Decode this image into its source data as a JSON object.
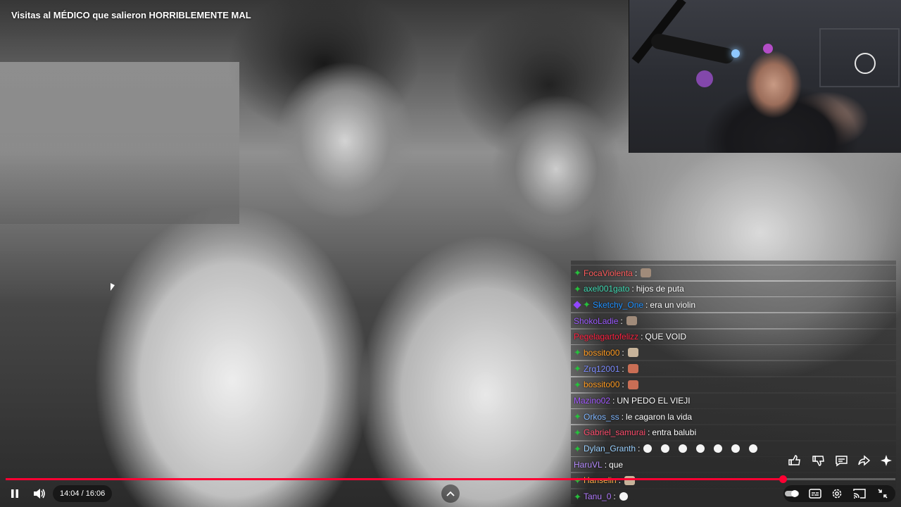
{
  "video": {
    "title": "Visitas al MÉDICO que salieron HORRIBLEMENTE MAL"
  },
  "chat": {
    "messages": [
      {
        "user": "FocaViolenta",
        "color": "#ff5c5c",
        "badges": [
          "green"
        ],
        "text": "",
        "emotes": [
          "cat"
        ]
      },
      {
        "user": "axel001gato",
        "color": "#3fd9b2",
        "badges": [
          "green"
        ],
        "text": "hijos de puta",
        "emotes": []
      },
      {
        "user": "Sketchy_One",
        "color": "#1e90ff",
        "badges": [
          "purple",
          "green"
        ],
        "text": "era un violin",
        "emotes": []
      },
      {
        "user": "ShokoLadie",
        "color": "#9b59ff",
        "badges": [],
        "text": "",
        "emotes": [
          "cat"
        ]
      },
      {
        "user": "Pegelagartofelizz",
        "color": "#ff2040",
        "badges": [],
        "text": "QUE VOID",
        "emotes": []
      },
      {
        "user": "bossito00",
        "color": "#ff9a1f",
        "badges": [
          "green"
        ],
        "text": "",
        "emotes": [
          "doge"
        ]
      },
      {
        "user": "Zrq12001",
        "color": "#7d8cff",
        "badges": [
          "green"
        ],
        "text": "",
        "emotes": [
          "face"
        ]
      },
      {
        "user": "bossito00",
        "color": "#ff9a1f",
        "badges": [
          "green"
        ],
        "text": "",
        "emotes": [
          "face"
        ]
      },
      {
        "user": "Mazino02",
        "color": "#a259ff",
        "badges": [],
        "text": "UN PEDO EL VIEJI",
        "emotes": []
      },
      {
        "user": "Orkos_ss",
        "color": "#7fb6ff",
        "badges": [
          "green"
        ],
        "text": "le cagaron la vida",
        "emotes": []
      },
      {
        "user": "Gabriel_samurai",
        "color": "#ff4d6d",
        "badges": [
          "green"
        ],
        "text": "entra balubi",
        "emotes": []
      },
      {
        "user": "Dylan_Granth",
        "color": "#9bd1ff",
        "badges": [
          "green"
        ],
        "text": "",
        "emotes": [
          "bubble",
          "bubble",
          "bubble",
          "bubble",
          "bubble",
          "bubble",
          "bubble"
        ]
      },
      {
        "user": "HaruVL",
        "color": "#b68cff",
        "badges": [],
        "text": "que",
        "emotes": []
      },
      {
        "user": "Hanselin",
        "color": "#ffb14a",
        "badges": [
          "green"
        ],
        "text": "",
        "emotes": [
          "doge"
        ]
      },
      {
        "user": "Tanu_0",
        "color": "#b37bff",
        "badges": [
          "green"
        ],
        "text": "",
        "emotes": [
          "bubble"
        ]
      }
    ]
  },
  "player": {
    "current_time": "14:04",
    "separator": " / ",
    "duration": "16:06",
    "progress_fraction": 0.8733,
    "accent": "#ff0033",
    "icons": {
      "play_pause": "pause-icon",
      "volume": "volume-icon",
      "chapters": "chevron-up-icon",
      "like": "thumbs-up-icon",
      "dislike": "thumbs-down-icon",
      "comment": "comment-icon",
      "share": "share-icon",
      "ask": "sparkle-icon",
      "autoplay": "autoplay-toggle-icon",
      "subtitles": "subtitles-icon",
      "settings": "gear-icon",
      "cast": "cast-icon",
      "exit_fullscreen": "exit-fullscreen-icon"
    }
  }
}
